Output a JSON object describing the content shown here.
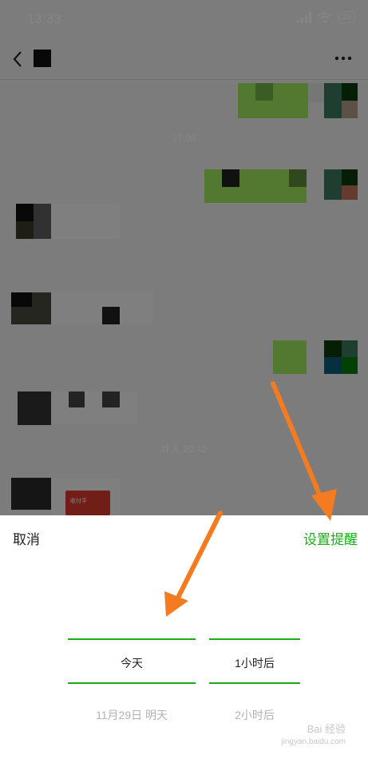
{
  "status": {
    "time": "13:33",
    "battery": "29"
  },
  "chat": {
    "timestamps": [
      "17:06",
      "昨天 20:42"
    ],
    "card_label": "收付平"
  },
  "sheet": {
    "cancel": "取消",
    "confirm": "设置提醒",
    "date_column": {
      "selected": "今天",
      "next": "11月29日 明天"
    },
    "hour_column": {
      "selected": "1小时后",
      "next": "2小时后"
    }
  },
  "watermark": {
    "brand": "Bai 经验",
    "domain": "jingyan.baidu.com"
  },
  "colors": {
    "accent": "#1aad19",
    "arrow": "#f47b20"
  }
}
